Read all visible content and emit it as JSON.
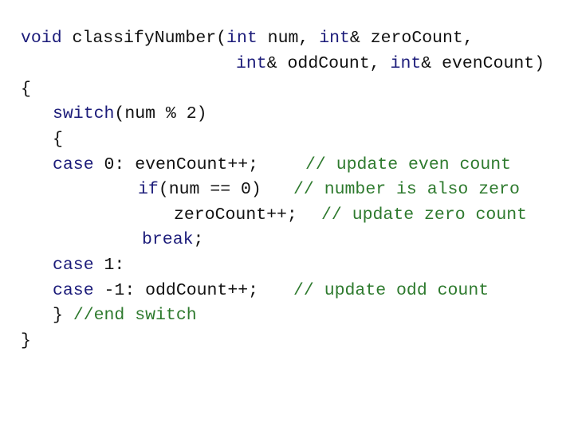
{
  "code": {
    "language": "C++",
    "colors": {
      "keyword": "#1c1c7a",
      "comment": "#2e7a2e",
      "text": "#111111"
    },
    "lines": [
      [
        {
          "t": "kw",
          "v": "void"
        },
        {
          "t": "tx",
          "v": " classifyNumber("
        },
        {
          "t": "kw",
          "v": "int"
        },
        {
          "t": "tx",
          "v": " num, "
        },
        {
          "t": "kw",
          "v": "int"
        },
        {
          "t": "tx",
          "v": "& zeroCount,"
        }
      ],
      [
        {
          "t": "kw",
          "v": "int"
        },
        {
          "t": "tx",
          "v": "& oddCount, "
        },
        {
          "t": "kw",
          "v": "int"
        },
        {
          "t": "tx",
          "v": "& evenCount)"
        }
      ],
      [
        {
          "t": "tx",
          "v": "{"
        }
      ],
      [
        {
          "t": "kw",
          "v": "switch"
        },
        {
          "t": "tx",
          "v": "(num % 2)"
        }
      ],
      [
        {
          "t": "tx",
          "v": "{"
        }
      ],
      [
        {
          "t": "kw",
          "v": "case"
        },
        {
          "t": "tx",
          "v": " 0: evenCount++;"
        }
      ],
      [
        {
          "t": "kw",
          "v": "if"
        },
        {
          "t": "tx",
          "v": "(num == 0)"
        }
      ],
      [
        {
          "t": "tx",
          "v": "zeroCount++;"
        }
      ],
      [
        {
          "t": "kw",
          "v": "break"
        },
        {
          "t": "tx",
          "v": ";"
        }
      ],
      [
        {
          "t": "kw",
          "v": "case"
        },
        {
          "t": "tx",
          "v": " 1:"
        }
      ],
      [
        {
          "t": "kw",
          "v": "case"
        },
        {
          "t": "tx",
          "v": " -1: oddCount++;"
        }
      ],
      [
        {
          "t": "tx",
          "v": "} "
        },
        {
          "t": "cm",
          "v": "//end switch"
        }
      ],
      [
        {
          "t": "tx",
          "v": "}"
        }
      ]
    ],
    "comments": [
      {
        "line": 5,
        "text": "// update even count"
      },
      {
        "line": 6,
        "text": "// number is also zero"
      },
      {
        "line": 7,
        "text": "// update zero count"
      },
      {
        "line": 10,
        "text": "// update odd count"
      }
    ]
  }
}
